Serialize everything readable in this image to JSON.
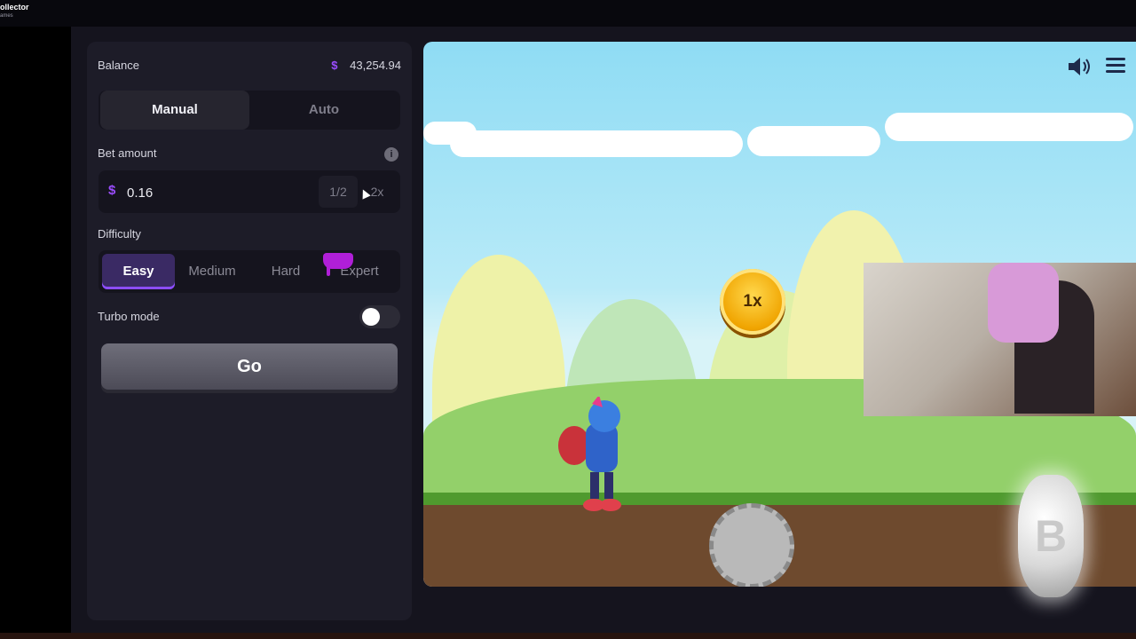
{
  "brand": {
    "title": "ollector",
    "subtitle": "ames"
  },
  "balance": {
    "label": "Balance",
    "currency": "$",
    "value": "43,254.94"
  },
  "mode_tabs": [
    {
      "label": "Manual",
      "active": true
    },
    {
      "label": "Auto",
      "active": false
    }
  ],
  "bet": {
    "label": "Bet amount",
    "currency": "$",
    "value": "0.16",
    "half_label": "1/2",
    "double_label": "2x",
    "info_icon": "info-icon"
  },
  "difficulty": {
    "label": "Difficulty",
    "options": [
      "Easy",
      "Medium",
      "Hard",
      "Expert"
    ],
    "selected": "Easy"
  },
  "turbo": {
    "label": "Turbo mode",
    "enabled": false
  },
  "go_button": {
    "label": "Go"
  },
  "game": {
    "multiplier": "1x",
    "icons": [
      "speaker-icon",
      "menu-icon"
    ],
    "sky_color": "#8fdcf4"
  },
  "overlay": {
    "coin_symbol": "B"
  },
  "colors": {
    "accent": "#9b4dff",
    "panel": "#1d1c28",
    "background": "#15141e"
  }
}
